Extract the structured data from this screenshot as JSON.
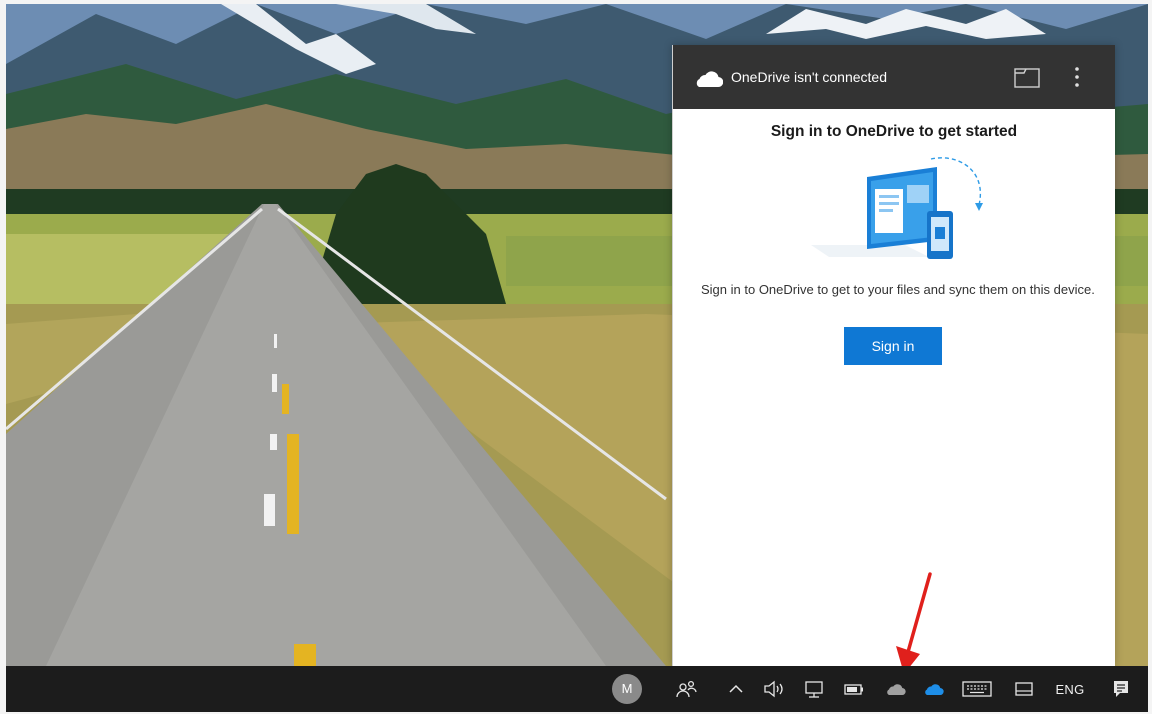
{
  "flyout": {
    "header_title": "OneDrive isn't connected",
    "heading": "Sign in to OneDrive to get started",
    "description": "Sign in to OneDrive to get to your files and sync them on this device.",
    "signin_button": "Sign in"
  },
  "taskbar": {
    "avatar_initial": "M",
    "language": "ENG"
  },
  "icons": {
    "header_cloud": "onedrive-cloud-icon",
    "folder": "folder-icon",
    "more": "more-options-icon",
    "people": "people-icon",
    "tray_chevron": "chevron-up-icon",
    "volume": "volume-icon",
    "network": "network-icon",
    "battery": "battery-icon",
    "onedrive_gray": "onedrive-gray-cloud-icon",
    "onedrive_blue": "onedrive-blue-cloud-icon",
    "keyboard": "touch-keyboard-icon",
    "tablet": "tablet-icon",
    "notifications": "action-center-icon"
  },
  "colors": {
    "accent": "#0f78d4",
    "header_bg": "#333333",
    "taskbar_bg": "#1c1c1c",
    "annotation": "#e0201c"
  }
}
